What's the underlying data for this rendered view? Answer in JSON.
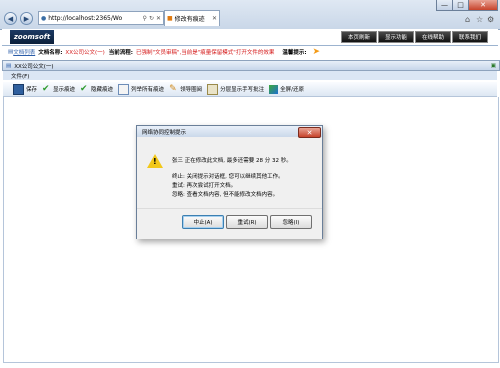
{
  "browser": {
    "address": "http://localhost:2365/Wo",
    "tab_title": "修改有痕迹",
    "minimize_icon": "minimize-icon",
    "close_icon": "close-icon"
  },
  "app": {
    "logo": "zoomsoft",
    "top_buttons": [
      "本页刷新",
      "显示功能",
      "在线帮助",
      "联系我们"
    ],
    "info": {
      "doc_link": "文档列表",
      "doc_name_label": "文档名称:",
      "doc_name_value": "XX公司公文(一)",
      "flow_label": "当前流程:",
      "flow_value": "已强制\"文员审稿\",当前是\"痕量保留模式\"打开文件的效果",
      "hint_label": "温馨提示:"
    }
  },
  "panel": {
    "title": "XX公司公文(一)",
    "menu": "文件(F)",
    "toolbar": [
      "保存",
      "显示痕迹",
      "隐藏痕迹",
      "列举所有痕迹",
      "领导圈阅",
      "分层显示手写批注",
      "全屏/还原"
    ]
  },
  "dialog": {
    "title": "网络协同控制提示",
    "line1": "张三 正在修改此文档, 最多还需要 28 分 32 秒。",
    "line2": "终止: 关闭提示对话框, 您可以继续其他工作。",
    "line3": "重试: 再次尝试打开文档。",
    "line4": "忽略: 查看文档内容, 但不能修改文档内容。",
    "buttons": [
      "中止(A)",
      "重试(R)",
      "忽略(I)"
    ]
  },
  "colors": {
    "accent": "#d41414",
    "chrome": "#c9d7e8"
  }
}
